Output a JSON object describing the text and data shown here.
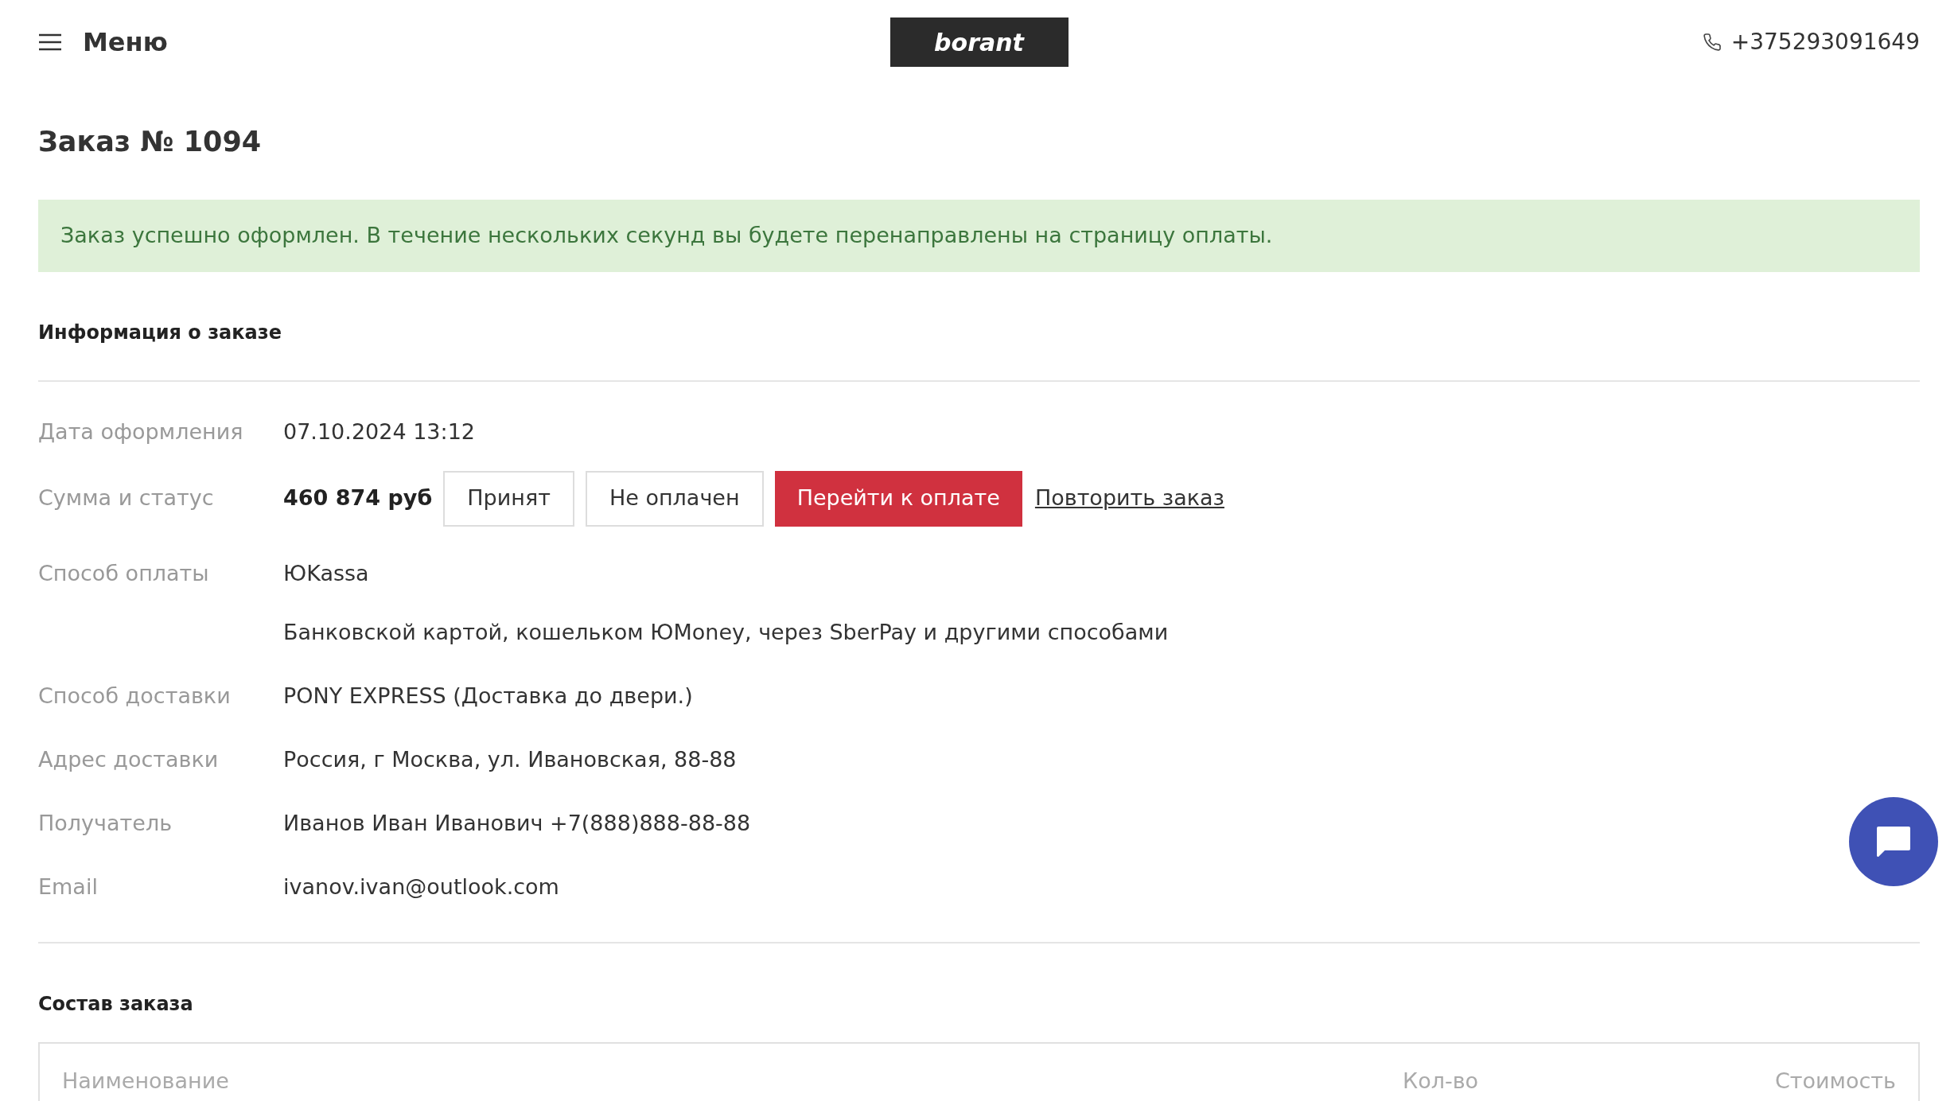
{
  "header": {
    "menu_label": "Меню",
    "logo": "borant",
    "phone": "+375293091649"
  },
  "title": "Заказ № 1094",
  "alert": "Заказ успешно оформлен. В течение нескольких секунд вы будете перенаправлены на страницу оплаты.",
  "info": {
    "heading": "Информация о заказе",
    "rows": [
      {
        "kind": "text",
        "label": "Дата оформления",
        "value": "07.10.2024 13:12"
      },
      {
        "kind": "status",
        "label": "Сумма и статус",
        "amount": "460 874 руб",
        "badges": [
          "Принят",
          "Не оплачен"
        ],
        "pay_button": "Перейти к оплате",
        "repeat_link": "Повторить заказ"
      },
      {
        "kind": "text",
        "label": "Способ оплаты",
        "value": "ЮKassa",
        "note": "Банковской картой, кошельком ЮMoney, через SberPay и другими способами"
      },
      {
        "kind": "text",
        "label": "Способ доставки",
        "value": "PONY EXPRESS (Доставка до двери.)"
      },
      {
        "kind": "text",
        "label": "Адрес доставки",
        "value": "Россия, г Москва, ул. Ивановская, 88-88"
      },
      {
        "kind": "text",
        "label": "Получатель",
        "value": "Иванов Иван Иванович +7(888)888-88-88"
      },
      {
        "kind": "text",
        "label": "Email",
        "value": "ivanov.ivan@outlook.com"
      }
    ]
  },
  "composition": {
    "heading": "Состав заказа",
    "columns": [
      "Наименование",
      "Кол-во",
      "Стоимость"
    ]
  }
}
